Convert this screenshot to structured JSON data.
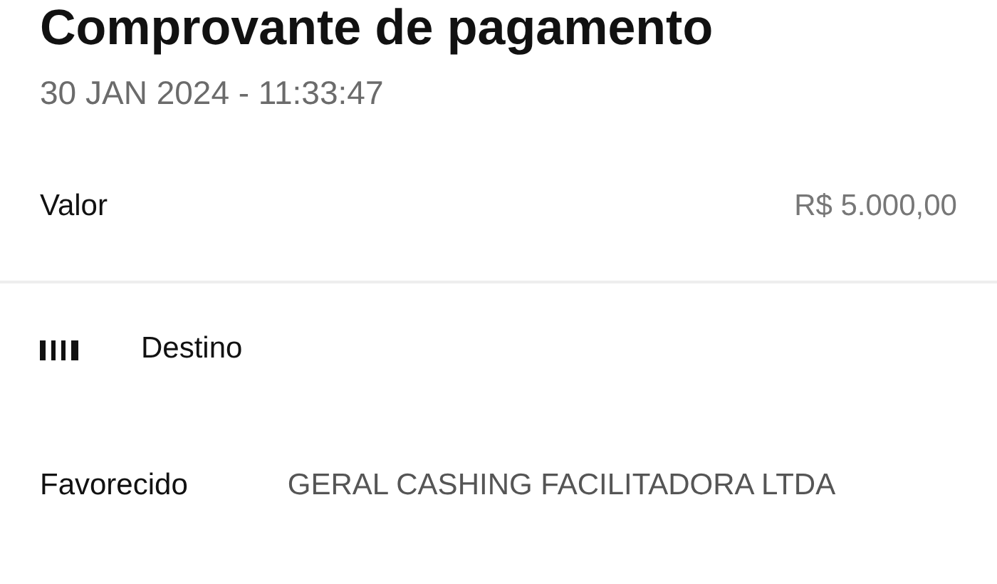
{
  "title": "Comprovante de pagamento",
  "datetime": "30 JAN 2024 - 11:33:47",
  "amount": {
    "label": "Valor",
    "value": "R$ 5.000,00"
  },
  "section": {
    "title": "Destino"
  },
  "fields": [
    {
      "label": "Favorecido",
      "value": "GERAL CASHING FACILITADORA LTDA"
    }
  ]
}
